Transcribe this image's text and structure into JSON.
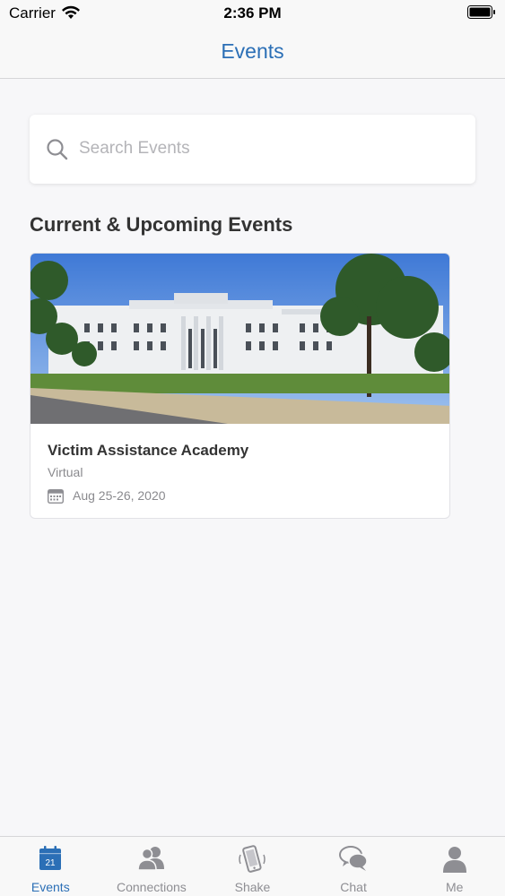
{
  "status_bar": {
    "carrier": "Carrier",
    "time": "2:36 PM"
  },
  "nav": {
    "title": "Events"
  },
  "search": {
    "placeholder": "Search Events",
    "value": ""
  },
  "section": {
    "title": "Current & Upcoming Events"
  },
  "events": [
    {
      "name": "Victim Assistance Academy",
      "location": "Virtual",
      "date": "Aug 25-26, 2020"
    }
  ],
  "tabs": [
    {
      "label": "Events",
      "icon": "calendar-icon",
      "active": true,
      "calendar_day": "21"
    },
    {
      "label": "Connections",
      "icon": "people-icon",
      "active": false
    },
    {
      "label": "Shake",
      "icon": "phone-shake-icon",
      "active": false
    },
    {
      "label": "Chat",
      "icon": "chat-bubbles-icon",
      "active": false
    },
    {
      "label": "Me",
      "icon": "person-icon",
      "active": false
    }
  ],
  "colors": {
    "accent": "#2b6fb6",
    "tab_inactive": "#8e8e93",
    "background": "#f7f7f9"
  }
}
